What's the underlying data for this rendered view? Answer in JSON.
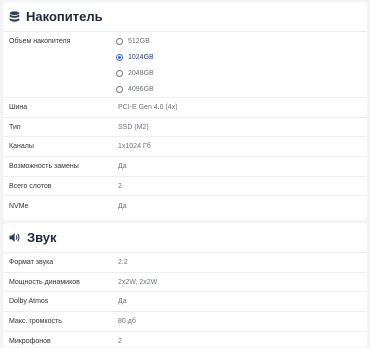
{
  "storage": {
    "title": "Накопитель",
    "icon": "database-icon",
    "volume": {
      "label": "Объем накопителя",
      "options": [
        "512GB",
        "1024GB",
        "2048GB",
        "4096GB"
      ],
      "selected": "1024GB"
    },
    "specs": [
      {
        "label": "Шина",
        "value": "PCI-E Gen 4.0 (4x)"
      },
      {
        "label": "Тип",
        "value": "SSD (M2)"
      },
      {
        "label": "Каналы",
        "value": "1x1024 Гб"
      },
      {
        "label": "Возможность замены",
        "value": "Да"
      },
      {
        "label": "Всего слотов",
        "value": "2"
      },
      {
        "label": "NVMe",
        "value": "Да"
      }
    ]
  },
  "sound": {
    "title": "Звук",
    "icon": "speaker-icon",
    "specs": [
      {
        "label": "Формат звука",
        "value": "2.2"
      },
      {
        "label": "Мощность динамиков",
        "value": "2x2W, 2x2W"
      },
      {
        "label": "Dolby Atmos",
        "value": "Да"
      },
      {
        "label": "Макс. громкость",
        "value": "80 дб"
      },
      {
        "label": "Микрофонов",
        "value": "2"
      }
    ]
  },
  "colors": {
    "accent": "#3b6fd6",
    "icon": "#2f3f56",
    "background": "#f3f4f6"
  }
}
